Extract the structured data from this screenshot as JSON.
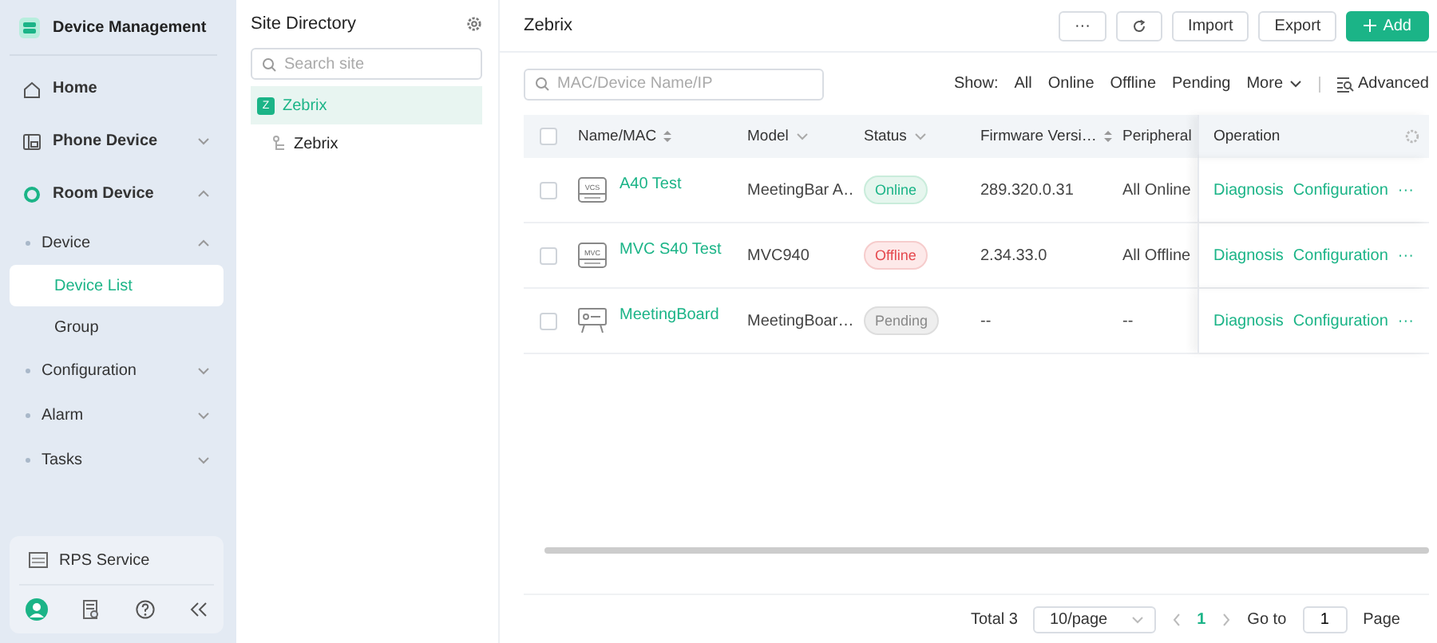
{
  "app": {
    "title": "Device Management"
  },
  "nav": [
    {
      "label": "Home",
      "selected": false
    },
    {
      "label": "Phone Device",
      "selected": false,
      "expanded": false
    },
    {
      "label": "Room Device",
      "selected": false,
      "expanded": true,
      "children": [
        {
          "label": "Device",
          "selected": false,
          "expanded": true,
          "children": [
            {
              "label": "Device List",
              "selected": true
            },
            {
              "label": "Group",
              "selected": false
            }
          ]
        },
        {
          "label": "Configuration",
          "selected": false,
          "expanded": false
        },
        {
          "label": "Alarm",
          "selected": false,
          "expanded": false
        },
        {
          "label": "Tasks",
          "selected": false,
          "expanded": false
        }
      ]
    }
  ],
  "sidebar_footer": {
    "service": "RPS Service"
  },
  "site_directory": {
    "title": "Site Directory",
    "search": {
      "placeholder": "Search site"
    },
    "sites": [
      {
        "label": "Zebrix",
        "badge": "Z",
        "selected": true,
        "children": [
          {
            "label": "Zebrix",
            "selected": false
          }
        ]
      }
    ]
  },
  "main": {
    "title": "Zebrix",
    "buttons": [
      {
        "kind": "more",
        "label": "···"
      },
      {
        "kind": "refresh"
      },
      {
        "kind": "plain",
        "label": "Import"
      },
      {
        "kind": "plain",
        "label": "Export"
      },
      {
        "kind": "primary",
        "label": "Add"
      }
    ],
    "search": {
      "placeholder": "MAC/Device Name/IP"
    },
    "show_label": "Show:",
    "filters": [
      {
        "label": "All",
        "selected": false
      },
      {
        "label": "Online",
        "selected": false
      },
      {
        "label": "Offline",
        "selected": false
      },
      {
        "label": "Pending",
        "selected": false
      }
    ],
    "more": "More",
    "advanced": "Advanced"
  },
  "table": {
    "select_all_checked": false,
    "columns": [
      {
        "label": "Name/MAC",
        "kind": "sort"
      },
      {
        "label": "Model",
        "kind": "filter"
      },
      {
        "label": "Status",
        "kind": "filter"
      },
      {
        "label": "Firmware Versi…",
        "kind": "sort"
      },
      {
        "label": "Peripheral",
        "kind": "plain"
      },
      {
        "label": "Operation",
        "kind": "settings"
      }
    ],
    "rows": [
      {
        "checked": false,
        "kind": "bar",
        "icon_label": "VCS",
        "name": "A40 Test",
        "model": "MeetingBar A…",
        "status": {
          "label": "Online",
          "kind": "online"
        },
        "firmware": "289.320.0.31",
        "peripheral": "All Online",
        "actions": [
          "Diagnosis",
          "Configuration",
          "···"
        ]
      },
      {
        "checked": false,
        "kind": "bar",
        "icon_label": "MVC",
        "name": "MVC S40 Test",
        "model": "MVC940",
        "status": {
          "label": "Offline",
          "kind": "offline"
        },
        "firmware": "2.34.33.0",
        "peripheral": "All Offline",
        "actions": [
          "Diagnosis",
          "Configuration",
          "···"
        ]
      },
      {
        "checked": false,
        "kind": "board",
        "name": "MeetingBoard",
        "model": "MeetingBoar…",
        "status": {
          "label": "Pending",
          "kind": "pending"
        },
        "firmware": "--",
        "peripheral": "--",
        "actions": [
          "Diagnosis",
          "Configuration",
          "···"
        ]
      }
    ]
  },
  "pagination": {
    "total": "Total 3",
    "page_size": "10/page",
    "pages": [
      {
        "label": "1",
        "selected": true
      }
    ],
    "goto_label": "Go to",
    "goto_value": "1",
    "page_label": "Page"
  }
}
